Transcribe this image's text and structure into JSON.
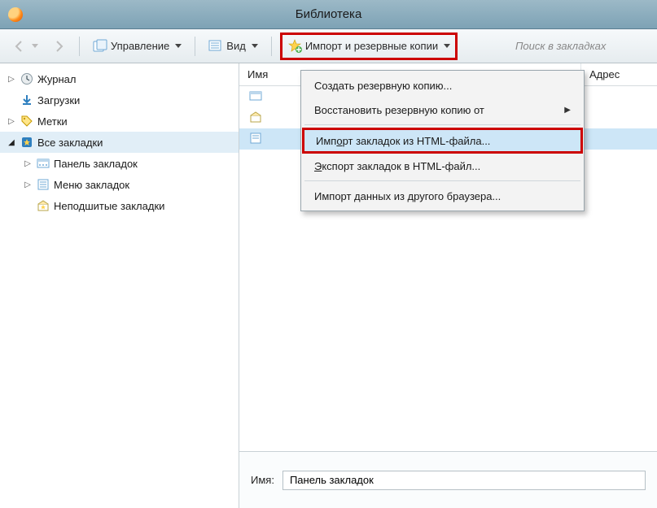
{
  "window": {
    "title": "Библиотека"
  },
  "toolbar": {
    "manage_label": "Управление",
    "view_label": "Вид",
    "import_label": "Импорт и резервные копии",
    "search_placeholder": "Поиск в закладках"
  },
  "sidebar": {
    "items": [
      {
        "label": "Журнал"
      },
      {
        "label": "Загрузки"
      },
      {
        "label": "Метки"
      },
      {
        "label": "Все закладки"
      }
    ],
    "bookmarks_children": [
      {
        "label": "Панель закладок"
      },
      {
        "label": "Меню закладок"
      },
      {
        "label": "Неподшитые закладки"
      }
    ]
  },
  "columns": {
    "name": "Имя",
    "address": "Адрес"
  },
  "rows": [
    {
      "label": ""
    },
    {
      "label": ""
    },
    {
      "label": ""
    }
  ],
  "menu": {
    "backup": "Создать резервную копию...",
    "restore": "Восстановить резервную копию от",
    "import_html_pre": "Имп",
    "import_html_u": "о",
    "import_html_post": "рт закладок из HTML-файла...",
    "export_html_pre": "",
    "export_html_u": "Э",
    "export_html_post": "кспорт закладок в HTML-файл...",
    "import_browser": "Импорт данных из другого браузера..."
  },
  "details": {
    "name_label": "Имя:",
    "name_value": "Панель закладок"
  }
}
